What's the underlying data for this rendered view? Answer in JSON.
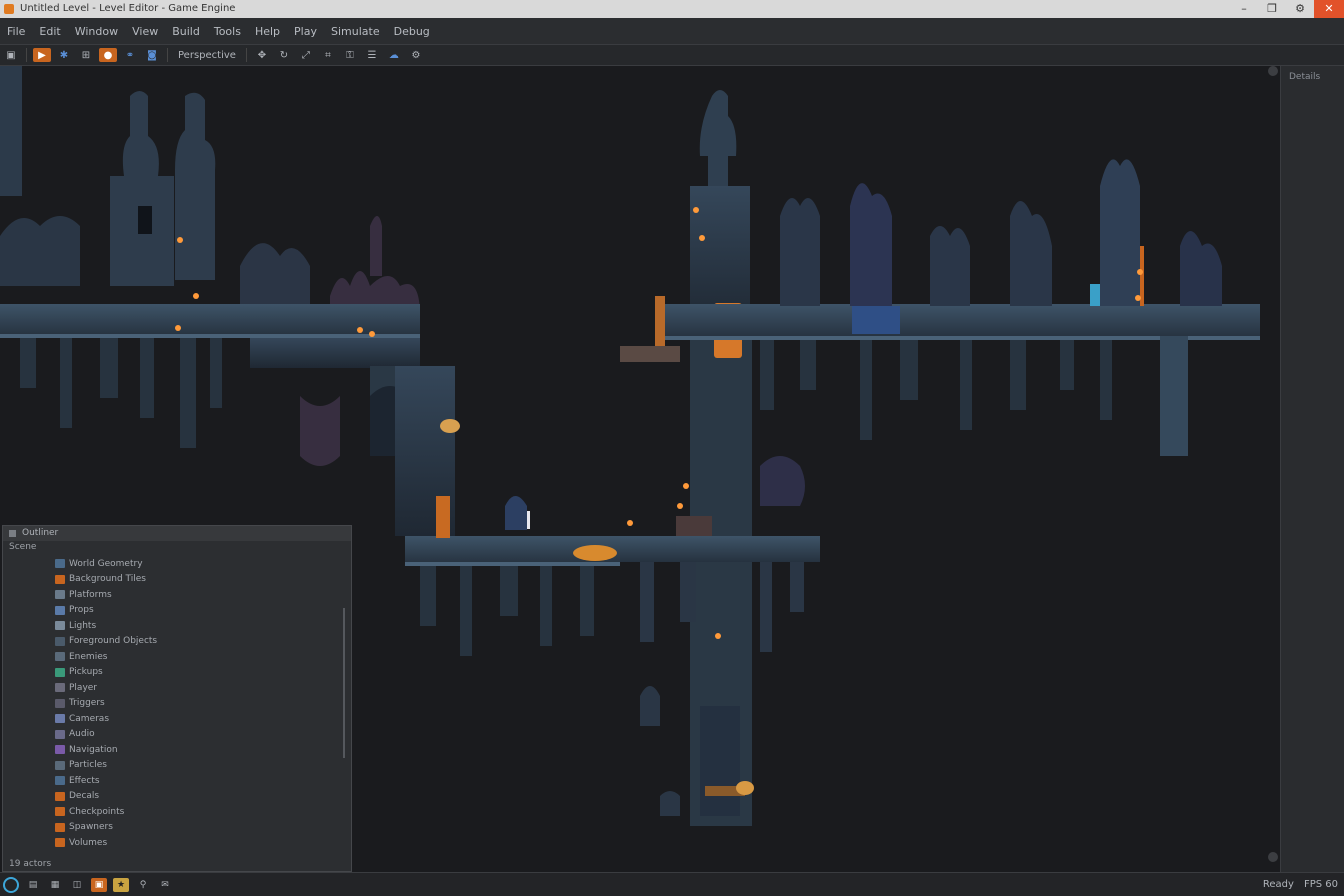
{
  "window": {
    "title": "Untitled Level - Level Editor - Game Engine",
    "controls": [
      "–",
      "❐",
      "⚙",
      "✕"
    ]
  },
  "menubar": {
    "items": [
      "File",
      "Edit",
      "Window",
      "View",
      "Build",
      "Tools",
      "Help",
      "Play",
      "Simulate",
      "Debug"
    ]
  },
  "toolbar": {
    "buttons": [
      {
        "icon": "save-icon",
        "glyph": "▣",
        "style": "plain"
      },
      {
        "icon": "play-icon",
        "glyph": "▶",
        "style": "orange"
      },
      {
        "icon": "gear-icon",
        "glyph": "✱",
        "style": "blue"
      },
      {
        "icon": "grid-icon",
        "glyph": "⊞",
        "style": "plain"
      },
      {
        "icon": "circle-icon",
        "glyph": "●",
        "style": "orange"
      },
      {
        "icon": "link-icon",
        "glyph": "⚭",
        "style": "blue"
      },
      {
        "icon": "camera-icon",
        "glyph": "◙",
        "style": "blue"
      }
    ],
    "label_1": "Perspective",
    "tools": [
      {
        "icon": "move-icon",
        "glyph": "✥"
      },
      {
        "icon": "rotate-icon",
        "glyph": "↻"
      },
      {
        "icon": "scale-icon",
        "glyph": "⤢"
      },
      {
        "icon": "snap-icon",
        "glyph": "⌗"
      },
      {
        "icon": "lock-icon",
        "glyph": "⚿"
      },
      {
        "icon": "layers-icon",
        "glyph": "☰"
      },
      {
        "icon": "cloud-icon",
        "glyph": "☁"
      },
      {
        "icon": "settings-icon",
        "glyph": "⚙"
      }
    ]
  },
  "outliner": {
    "title": "Outliner",
    "subtitle": "Scene",
    "items": [
      {
        "label": "World Geometry",
        "color": "#4a6a8a"
      },
      {
        "label": "Background Tiles",
        "color": "#c8651f"
      },
      {
        "label": "Platforms",
        "color": "#6a7a8a"
      },
      {
        "label": "Props",
        "color": "#5a7aa8"
      },
      {
        "label": "Lights",
        "color": "#7a8a9a"
      },
      {
        "label": "Foreground Objects",
        "color": "#4a5a6a"
      },
      {
        "label": "Enemies",
        "color": "#5a6a7a"
      },
      {
        "label": "Pickups",
        "color": "#3a9a7a"
      },
      {
        "label": "Player",
        "color": "#6a6a7a"
      },
      {
        "label": "Triggers",
        "color": "#5a5a6a"
      },
      {
        "label": "Cameras",
        "color": "#6a7aa8"
      },
      {
        "label": "Audio",
        "color": "#6a6a8a"
      },
      {
        "label": "Navigation",
        "color": "#7a5aa8"
      },
      {
        "label": "Particles",
        "color": "#5a6a7a"
      },
      {
        "label": "Effects",
        "color": "#4a6a8a"
      },
      {
        "label": "Decals",
        "color": "#c8651f"
      },
      {
        "label": "Checkpoints",
        "color": "#c8651f"
      },
      {
        "label": "Spawners",
        "color": "#c8651f"
      },
      {
        "label": "Volumes",
        "color": "#c8651f"
      }
    ],
    "footer": "19 actors"
  },
  "statusbar": {
    "buttons": [
      {
        "icon": "ring-icon",
        "style": "ring",
        "glyph": ""
      },
      {
        "icon": "content-icon",
        "style": "plain",
        "glyph": "▤"
      },
      {
        "icon": "folder-icon",
        "style": "plain",
        "glyph": "▦"
      },
      {
        "icon": "console-icon",
        "style": "plain",
        "glyph": "◫"
      },
      {
        "icon": "build-icon",
        "style": "orange",
        "glyph": "▣"
      },
      {
        "icon": "star-icon",
        "style": "yellow",
        "glyph": "★"
      },
      {
        "icon": "pin-icon",
        "style": "plain",
        "glyph": "⚲"
      },
      {
        "icon": "message-icon",
        "style": "plain",
        "glyph": "✉"
      }
    ],
    "right": [
      "Ready",
      "FPS 60"
    ]
  },
  "viewport": {
    "right_label": "Details"
  }
}
